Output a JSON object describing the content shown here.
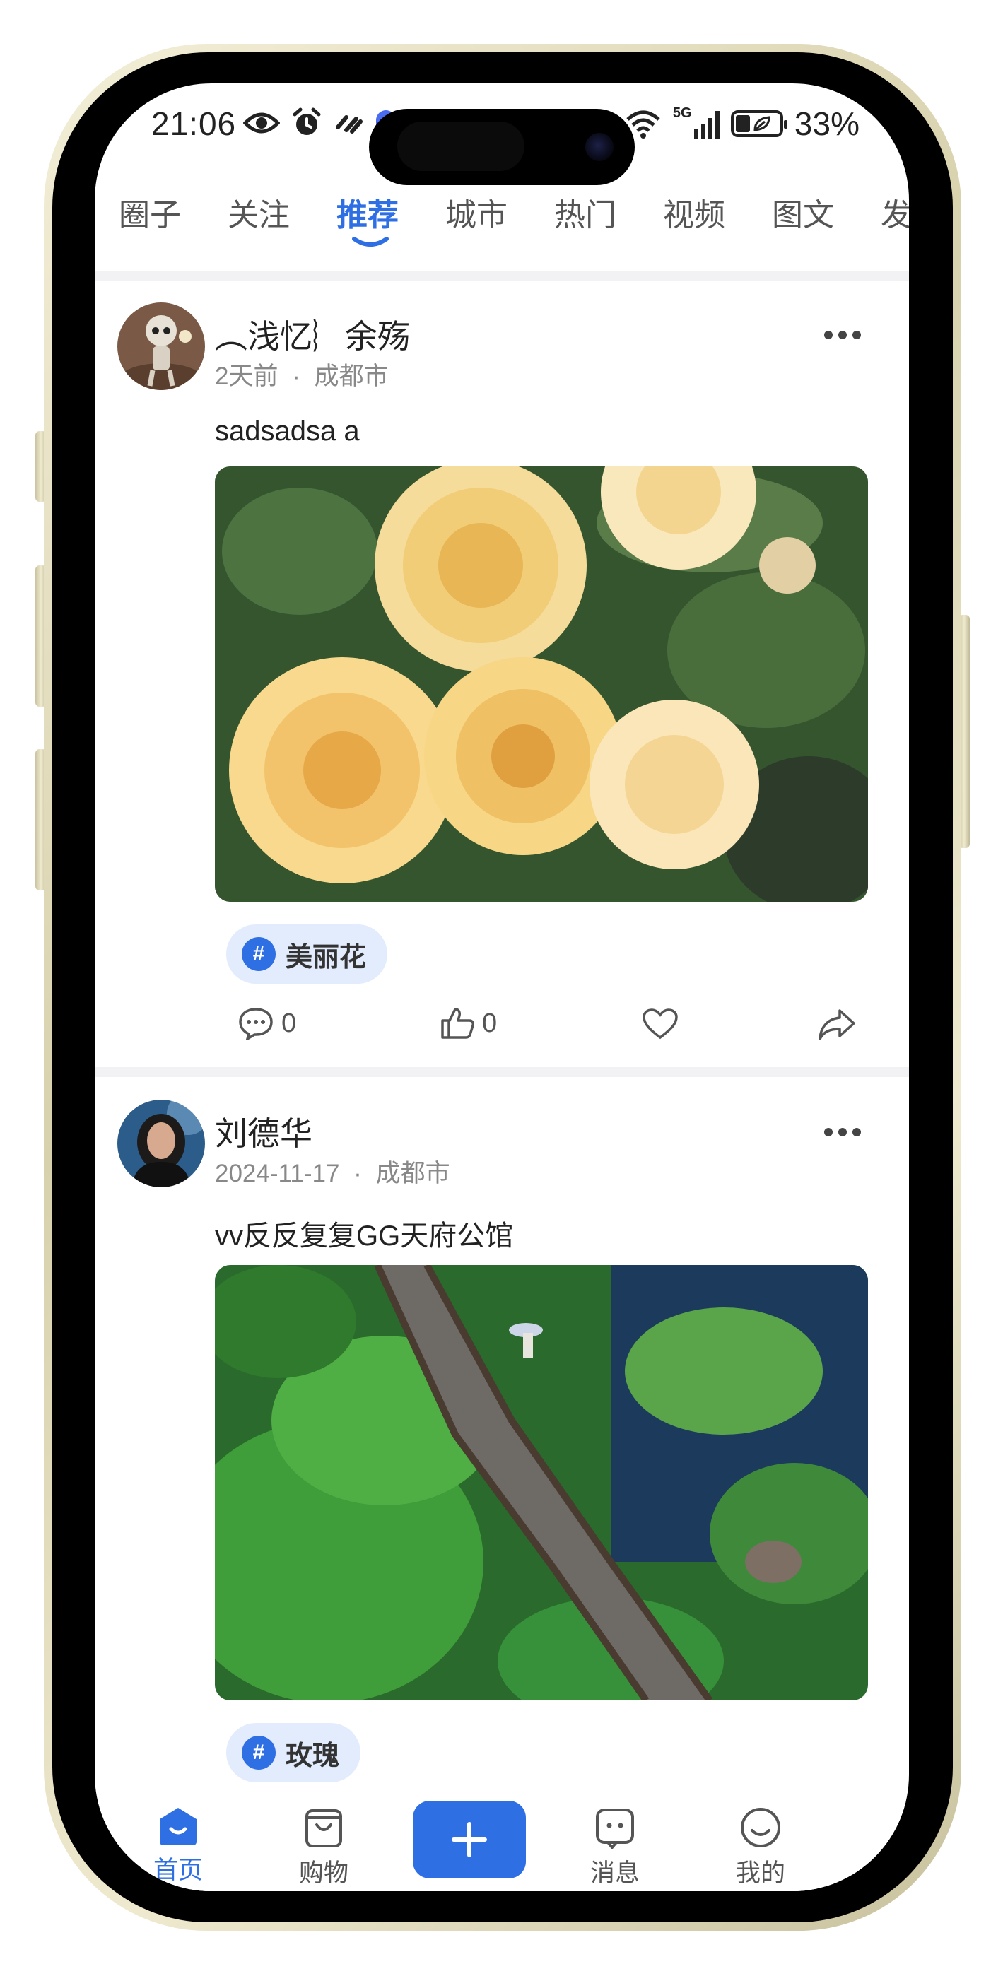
{
  "status_bar": {
    "time": "21:06",
    "network": "5G",
    "battery_percent": "33%",
    "left_icons": [
      "eye-icon",
      "alarm-icon",
      "link-icon"
    ],
    "right_icons": [
      "wifi-icon",
      "signal-icon",
      "battery-icon"
    ]
  },
  "tabs": [
    {
      "label": "圈子",
      "active": false
    },
    {
      "label": "关注",
      "active": false
    },
    {
      "label": "推荐",
      "active": true
    },
    {
      "label": "城市",
      "active": false
    },
    {
      "label": "热门",
      "active": false
    },
    {
      "label": "视频",
      "active": false
    },
    {
      "label": "图文",
      "active": false
    },
    {
      "label": "发",
      "active": false
    }
  ],
  "posts": [
    {
      "username": "︵浅忆︴余殇",
      "time": "2天前",
      "separator": "·",
      "location": "成都市",
      "text": "sadsadsa a",
      "image": "yellow-roses-photo",
      "tag": "美丽花",
      "comments": "0",
      "likes": "0"
    },
    {
      "username": "刘德华",
      "time": "2024-11-17",
      "separator": "·",
      "location": "成都市",
      "text": "vv反反复复GG天府公馆",
      "image": "lotus-pond-bridge-photo",
      "tag": "玫瑰"
    }
  ],
  "bottom_nav": [
    {
      "label": "首页",
      "icon": "home-icon",
      "active": true
    },
    {
      "label": "购物",
      "icon": "shopping-bag-icon",
      "active": false
    },
    {
      "label": "",
      "icon": "plus-icon",
      "active": false
    },
    {
      "label": "消息",
      "icon": "message-icon",
      "active": false
    },
    {
      "label": "我的",
      "icon": "smiley-icon",
      "active": false
    }
  ],
  "colors": {
    "accent": "#2f6fe4",
    "tag_bg": "#e3ecfd",
    "frame": "#e6e0c2"
  }
}
